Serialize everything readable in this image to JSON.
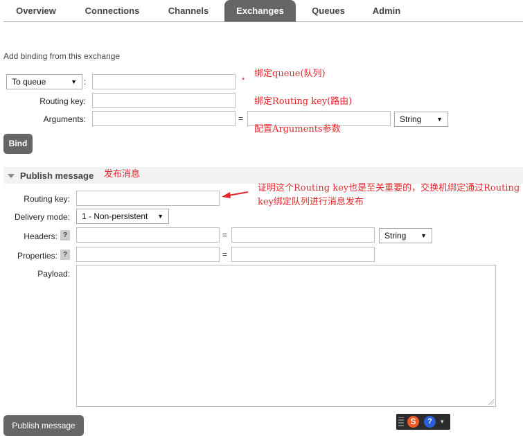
{
  "nav": {
    "tabs": [
      {
        "label": "Overview"
      },
      {
        "label": "Connections"
      },
      {
        "label": "Channels"
      },
      {
        "label": "Exchanges",
        "active": true
      },
      {
        "label": "Queues"
      },
      {
        "label": "Admin"
      }
    ]
  },
  "binding": {
    "heading": "Add binding from this exchange",
    "destination_type": "To queue",
    "colon": ":",
    "routing_key_label": "Routing key:",
    "arguments_label": "Arguments:",
    "equals": "=",
    "arg_type": "String",
    "bind_button": "Bind",
    "required_mark": "*"
  },
  "publish": {
    "title": "Publish message",
    "routing_key_label": "Routing key:",
    "delivery_mode_label": "Delivery mode:",
    "delivery_mode_value": "1 - Non-persistent",
    "headers_label": "Headers:",
    "properties_label": "Properties:",
    "payload_label": "Payload:",
    "help": "?",
    "equals": "=",
    "header_type": "String",
    "publish_button": "Publish message"
  },
  "annotations": {
    "bind_queue": "绑定queue(队列)",
    "bind_routing_key": "绑定Routing key(路由)",
    "config_arguments": "配置Arguments参数",
    "publish_message": "发布消息",
    "routing_note": "证明这个Routing key也是至关重要的，交换机绑定通过Routing key绑定队列进行消息发布"
  },
  "colors": {
    "annotation_red": "#e3262a",
    "tab_active_bg": "#666666",
    "button_bg": "#666666"
  }
}
